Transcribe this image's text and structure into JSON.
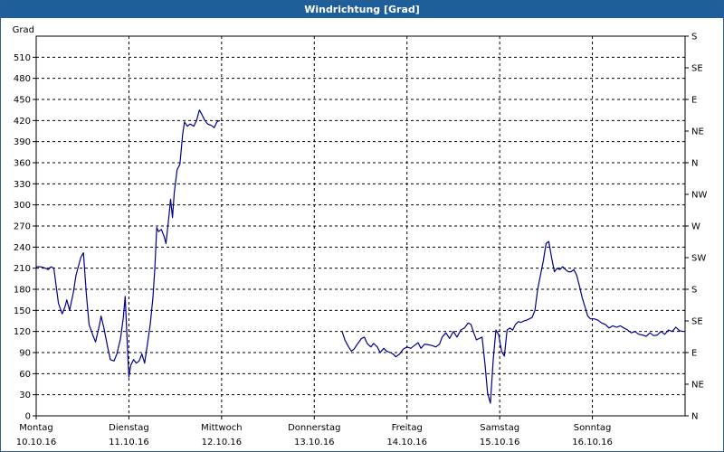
{
  "window": {
    "title": "Windrichtung [Grad]"
  },
  "chart_data": {
    "type": "line",
    "title": "Windrichtung [Grad]",
    "ylabel": "Grad",
    "ylim": [
      0,
      540
    ],
    "yticks": [
      0,
      30,
      60,
      90,
      120,
      150,
      180,
      210,
      240,
      270,
      300,
      330,
      360,
      390,
      420,
      450,
      480,
      510
    ],
    "right_axis": {
      "labels": [
        "N",
        "NE",
        "E",
        "SE",
        "S",
        "SW",
        "W",
        "NW",
        "N",
        "NE",
        "E",
        "SE",
        "S"
      ],
      "values": [
        0,
        45,
        90,
        135,
        180,
        225,
        270,
        315,
        360,
        405,
        450,
        495,
        540
      ]
    },
    "x_days": [
      {
        "day": "Montag",
        "date": "10.10.16"
      },
      {
        "day": "Dienstag",
        "date": "11.10.16"
      },
      {
        "day": "Mittwoch",
        "date": "12.10.16"
      },
      {
        "day": "Donnerstag",
        "date": "13.10.16"
      },
      {
        "day": "Freitag",
        "date": "14.10.16"
      },
      {
        "day": "Samstag",
        "date": "15.10.16"
      },
      {
        "day": "Sonntag",
        "date": "16.10.16"
      }
    ],
    "xlim": [
      0,
      7
    ],
    "grid": true,
    "line_color": "#00008b",
    "series": [
      {
        "segments": [
          [
            [
              0.0,
              212
            ],
            [
              0.05,
              212
            ],
            [
              0.1,
              210
            ],
            [
              0.13,
              208
            ],
            [
              0.16,
              212
            ],
            [
              0.19,
              210
            ],
            [
              0.21,
              190
            ],
            [
              0.24,
              160
            ],
            [
              0.28,
              145
            ],
            [
              0.31,
              155
            ],
            [
              0.33,
              165
            ],
            [
              0.36,
              150
            ],
            [
              0.4,
              175
            ],
            [
              0.43,
              200
            ],
            [
              0.48,
              225
            ],
            [
              0.51,
              232
            ],
            [
              0.54,
              175
            ],
            [
              0.57,
              130
            ],
            [
              0.61,
              115
            ],
            [
              0.64,
              105
            ],
            [
              0.68,
              128
            ],
            [
              0.7,
              142
            ],
            [
              0.73,
              125
            ],
            [
              0.77,
              98
            ],
            [
              0.8,
              80
            ],
            [
              0.84,
              78
            ],
            [
              0.87,
              88
            ],
            [
              0.91,
              110
            ],
            [
              0.94,
              140
            ],
            [
              0.96,
              170
            ],
            [
              0.98,
              110
            ],
            [
              1.0,
              55
            ],
            [
              1.02,
              72
            ],
            [
              1.05,
              80
            ],
            [
              1.08,
              75
            ],
            [
              1.11,
              78
            ],
            [
              1.14,
              88
            ],
            [
              1.17,
              75
            ],
            [
              1.2,
              102
            ],
            [
              1.23,
              130
            ],
            [
              1.26,
              170
            ],
            [
              1.28,
              210
            ],
            [
              1.3,
              268
            ],
            [
              1.32,
              262
            ],
            [
              1.35,
              265
            ],
            [
              1.38,
              255
            ],
            [
              1.4,
              245
            ],
            [
              1.43,
              282
            ],
            [
              1.45,
              308
            ],
            [
              1.47,
              282
            ],
            [
              1.49,
              318
            ],
            [
              1.52,
              350
            ],
            [
              1.55,
              358
            ],
            [
              1.58,
              400
            ],
            [
              1.6,
              418
            ],
            [
              1.63,
              412
            ],
            [
              1.66,
              415
            ],
            [
              1.7,
              412
            ],
            [
              1.73,
              420
            ],
            [
              1.76,
              435
            ],
            [
              1.79,
              428
            ],
            [
              1.82,
              420
            ],
            [
              1.85,
              415
            ],
            [
              1.89,
              413
            ],
            [
              1.92,
              410
            ],
            [
              1.95,
              418
            ],
            [
              1.98,
              420
            ]
          ],
          [
            [
              3.3,
              120
            ],
            [
              3.33,
              108
            ],
            [
              3.37,
              98
            ],
            [
              3.4,
              92
            ],
            [
              3.43,
              95
            ],
            [
              3.47,
              103
            ],
            [
              3.51,
              110
            ],
            [
              3.54,
              112
            ],
            [
              3.57,
              103
            ],
            [
              3.61,
              98
            ],
            [
              3.64,
              103
            ],
            [
              3.68,
              98
            ],
            [
              3.71,
              90
            ],
            [
              3.75,
              96
            ],
            [
              3.78,
              92
            ],
            [
              3.82,
              90
            ],
            [
              3.85,
              88
            ],
            [
              3.88,
              84
            ],
            [
              3.92,
              88
            ],
            [
              3.96,
              95
            ],
            [
              4.0,
              98
            ],
            [
              4.04,
              96
            ],
            [
              4.08,
              100
            ],
            [
              4.12,
              104
            ],
            [
              4.15,
              96
            ],
            [
              4.19,
              102
            ],
            [
              4.23,
              101
            ],
            [
              4.27,
              100
            ],
            [
              4.31,
              98
            ],
            [
              4.35,
              102
            ],
            [
              4.38,
              112
            ],
            [
              4.42,
              118
            ],
            [
              4.46,
              110
            ],
            [
              4.5,
              120
            ],
            [
              4.54,
              112
            ],
            [
              4.58,
              122
            ],
            [
              4.62,
              125
            ],
            [
              4.66,
              132
            ],
            [
              4.69,
              130
            ],
            [
              4.72,
              118
            ],
            [
              4.75,
              108
            ],
            [
              4.78,
              110
            ],
            [
              4.81,
              112
            ],
            [
              4.84,
              75
            ],
            [
              4.87,
              32
            ],
            [
              4.9,
              18
            ],
            [
              4.93,
              80
            ],
            [
              4.96,
              122
            ],
            [
              4.99,
              115
            ],
            [
              5.02,
              92
            ],
            [
              5.05,
              85
            ],
            [
              5.08,
              122
            ],
            [
              5.11,
              125
            ],
            [
              5.14,
              122
            ],
            [
              5.17,
              130
            ],
            [
              5.2,
              134
            ],
            [
              5.23,
              133
            ],
            [
              5.26,
              135
            ],
            [
              5.29,
              136
            ],
            [
              5.32,
              138
            ],
            [
              5.35,
              140
            ],
            [
              5.38,
              150
            ],
            [
              5.41,
              180
            ],
            [
              5.44,
              200
            ],
            [
              5.47,
              220
            ],
            [
              5.5,
              245
            ],
            [
              5.53,
              248
            ],
            [
              5.56,
              225
            ],
            [
              5.59,
              205
            ],
            [
              5.62,
              210
            ],
            [
              5.65,
              208
            ],
            [
              5.68,
              212
            ],
            [
              5.71,
              208
            ],
            [
              5.74,
              205
            ],
            [
              5.77,
              205
            ],
            [
              5.8,
              208
            ],
            [
              5.83,
              200
            ],
            [
              5.86,
              185
            ],
            [
              5.89,
              168
            ],
            [
              5.92,
              155
            ],
            [
              5.95,
              142
            ],
            [
              5.98,
              138
            ],
            [
              6.02,
              138
            ],
            [
              6.06,
              136
            ],
            [
              6.1,
              132
            ],
            [
              6.14,
              130
            ],
            [
              6.18,
              125
            ],
            [
              6.22,
              128
            ],
            [
              6.26,
              126
            ],
            [
              6.3,
              128
            ],
            [
              6.34,
              125
            ],
            [
              6.38,
              122
            ],
            [
              6.42,
              118
            ],
            [
              6.46,
              120
            ],
            [
              6.5,
              116
            ],
            [
              6.54,
              115
            ],
            [
              6.58,
              113
            ],
            [
              6.62,
              118
            ],
            [
              6.66,
              114
            ],
            [
              6.7,
              115
            ],
            [
              6.74,
              120
            ],
            [
              6.78,
              116
            ],
            [
              6.82,
              122
            ],
            [
              6.86,
              120
            ],
            [
              6.9,
              126
            ],
            [
              6.94,
              121
            ],
            [
              6.98,
              120
            ]
          ]
        ]
      }
    ]
  }
}
